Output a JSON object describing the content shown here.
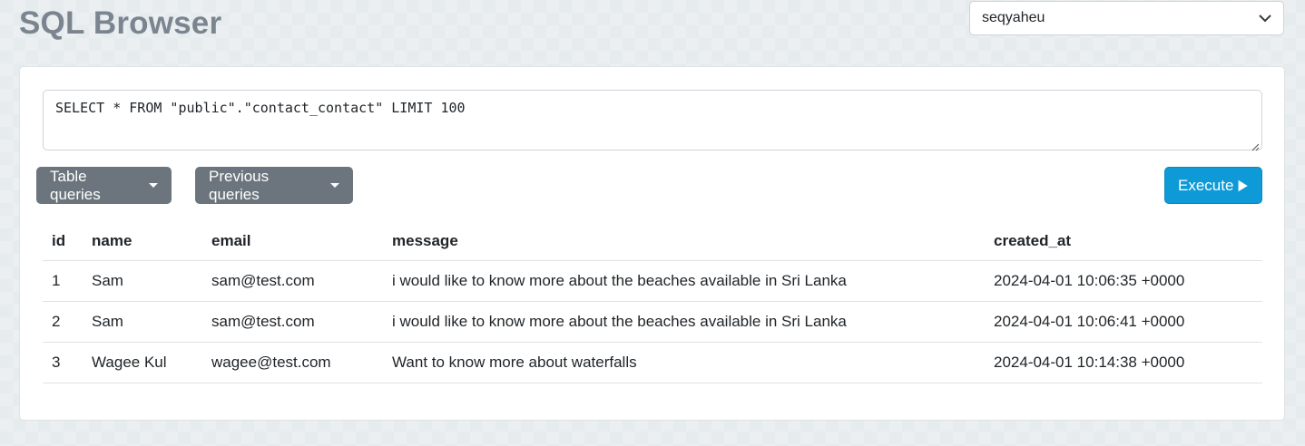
{
  "header": {
    "title": "SQL Browser"
  },
  "database_select": {
    "selected": "seqyaheu",
    "icon": "chevron-down-icon"
  },
  "editor": {
    "query": "SELECT * FROM \"public\".\"contact_contact\" LIMIT 100"
  },
  "toolbar": {
    "table_queries_label": "Table queries",
    "previous_queries_label": "Previous queries",
    "execute_label": "Execute",
    "execute_icon": "play-icon",
    "execute_color": "#0e9ad7"
  },
  "results": {
    "columns": [
      "id",
      "name",
      "email",
      "message",
      "created_at"
    ],
    "rows": [
      [
        "1",
        "Sam",
        "sam@test.com",
        "i would like to know more about the beaches available in Sri Lanka",
        "2024-04-01 10:06:35 +0000"
      ],
      [
        "2",
        "Sam",
        "sam@test.com",
        "i would like to know more about the beaches available in Sri Lanka",
        "2024-04-01 10:06:41 +0000"
      ],
      [
        "3",
        "Wagee Kul",
        "wagee@test.com",
        "Want to know more about waterfalls",
        "2024-04-01 10:14:38 +0000"
      ]
    ]
  }
}
